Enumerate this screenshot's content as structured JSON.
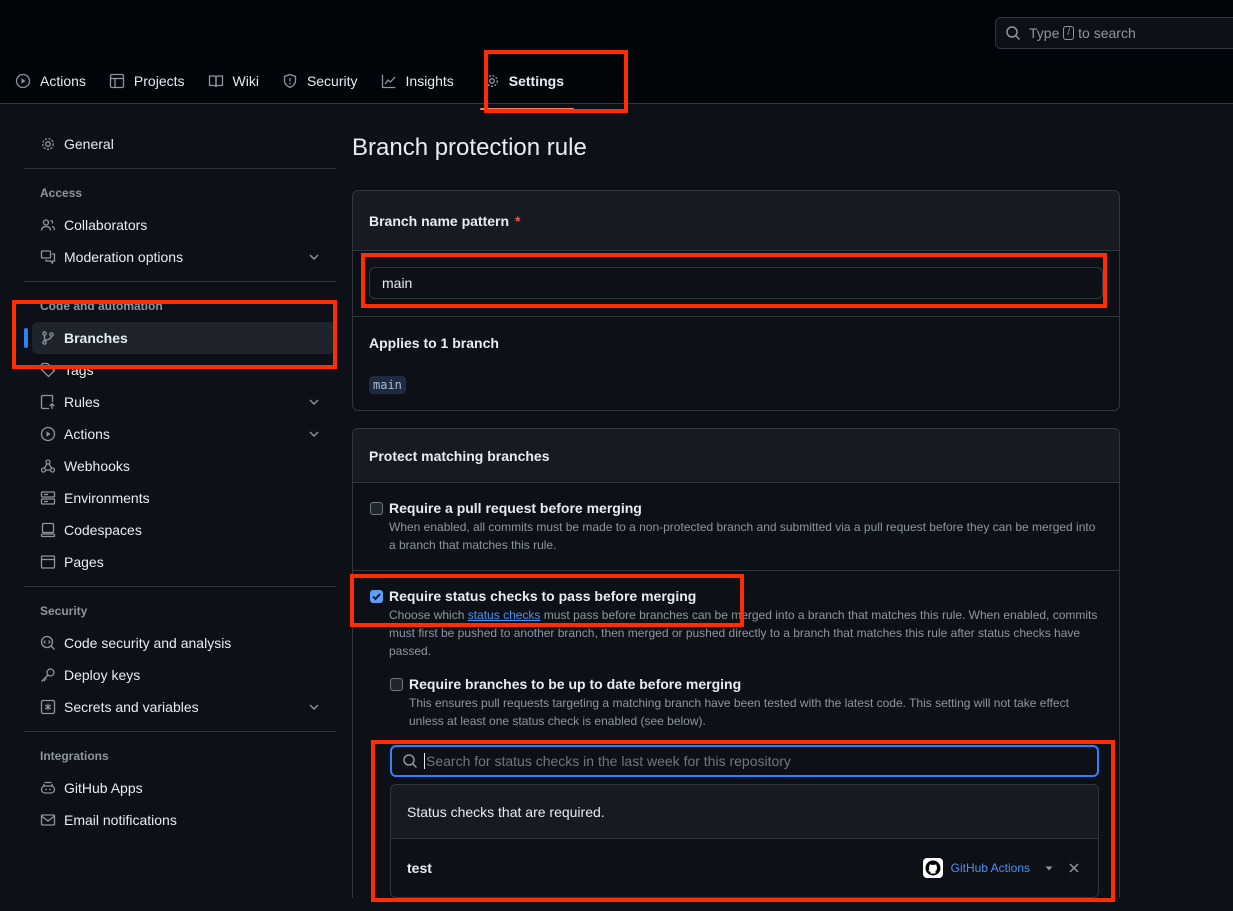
{
  "search": {
    "prefix": "Type",
    "key": "/",
    "suffix": "to search"
  },
  "nav": {
    "items": [
      {
        "label": "Actions",
        "icon": "play-icon"
      },
      {
        "label": "Projects",
        "icon": "table-icon"
      },
      {
        "label": "Wiki",
        "icon": "book-icon"
      },
      {
        "label": "Security",
        "icon": "shield-icon"
      },
      {
        "label": "Insights",
        "icon": "graph-icon"
      },
      {
        "label": "Settings",
        "icon": "gear-icon",
        "active": true
      }
    ]
  },
  "sidebar": {
    "general": "General",
    "access_heading": "Access",
    "collaborators": "Collaborators",
    "moderation": "Moderation options",
    "code_heading": "Code and automation",
    "branches": "Branches",
    "tags": "Tags",
    "rules": "Rules",
    "actions": "Actions",
    "webhooks": "Webhooks",
    "environments": "Environments",
    "codespaces": "Codespaces",
    "pages": "Pages",
    "security_heading": "Security",
    "code_security": "Code security and analysis",
    "deploy_keys": "Deploy keys",
    "secrets": "Secrets and variables",
    "integrations_heading": "Integrations",
    "github_apps": "GitHub Apps",
    "email_notifications": "Email notifications"
  },
  "main": {
    "title": "Branch protection rule",
    "pattern_label": "Branch name pattern",
    "pattern_required": "*",
    "pattern_value": "main",
    "applies_label": "Applies to 1 branch",
    "applies_branch": "main",
    "protect_heading": "Protect matching branches",
    "opt_pr_title": "Require a pull request before merging",
    "opt_pr_desc": "When enabled, all commits must be made to a non-protected branch and submitted via a pull request before they can be merged into a branch that matches this rule.",
    "opt_pr_checked": false,
    "opt_status_title": "Require status checks to pass before merging",
    "opt_status_desc_1": "Choose which",
    "opt_status_desc_link": "status checks",
    "opt_status_desc_2": "must pass before branches can be merged into a branch that matches this rule. When enabled, commits must first be pushed to another branch, then merged or pushed directly to a branch that matches this rule after status checks have passed.",
    "opt_status_checked": true,
    "opt_uptodate_title": "Require branches to be up to date before merging",
    "opt_uptodate_desc": "This ensures pull requests targeting a matching branch have been tested with the latest code. This setting will not take effect unless at least one status check is enabled (see below).",
    "opt_uptodate_checked": false,
    "sc_search_placeholder": "Search for status checks in the last week for this repository",
    "sc_required_heading": "Status checks that are required.",
    "sc_items": [
      {
        "name": "test",
        "provider": "GitHub Actions"
      }
    ]
  },
  "colors": {
    "highlight": "#ff2d00",
    "accent": "#2f81f7",
    "nav_underline": "#f78166"
  }
}
